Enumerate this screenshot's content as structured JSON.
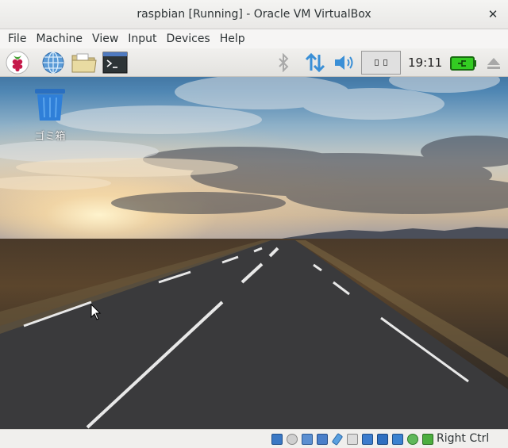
{
  "window": {
    "title": "raspbian [Running] - Oracle VM VirtualBox",
    "close_glyph": "✕"
  },
  "menubar": {
    "items": [
      "File",
      "Machine",
      "View",
      "Input",
      "Devices",
      "Help"
    ]
  },
  "guest": {
    "taskbar": {
      "launchers": [
        "raspberry-menu-icon",
        "web-browser-icon",
        "file-manager-icon",
        "terminal-icon"
      ],
      "tray": [
        "bluetooth-icon",
        "network-transfer-icon",
        "volume-icon"
      ],
      "clock": "19:11",
      "tray_right": [
        "battery-charging-icon",
        "eject-icon"
      ]
    },
    "desktop": {
      "trash_label": "ゴミ箱"
    }
  },
  "statusbar": {
    "icons": [
      "hard-disk-icon",
      "optical-drive-icon",
      "audio-icon",
      "network-icon",
      "usb-icon",
      "shared-folders-icon",
      "display-icon",
      "video-capture-icon",
      "cpu-icon",
      "mouse-integration-icon",
      "keyboard-icon"
    ],
    "host_key": "Right Ctrl"
  },
  "colors": {
    "accent_blue": "#3a8fd6",
    "battery_green": "#33cc22"
  }
}
